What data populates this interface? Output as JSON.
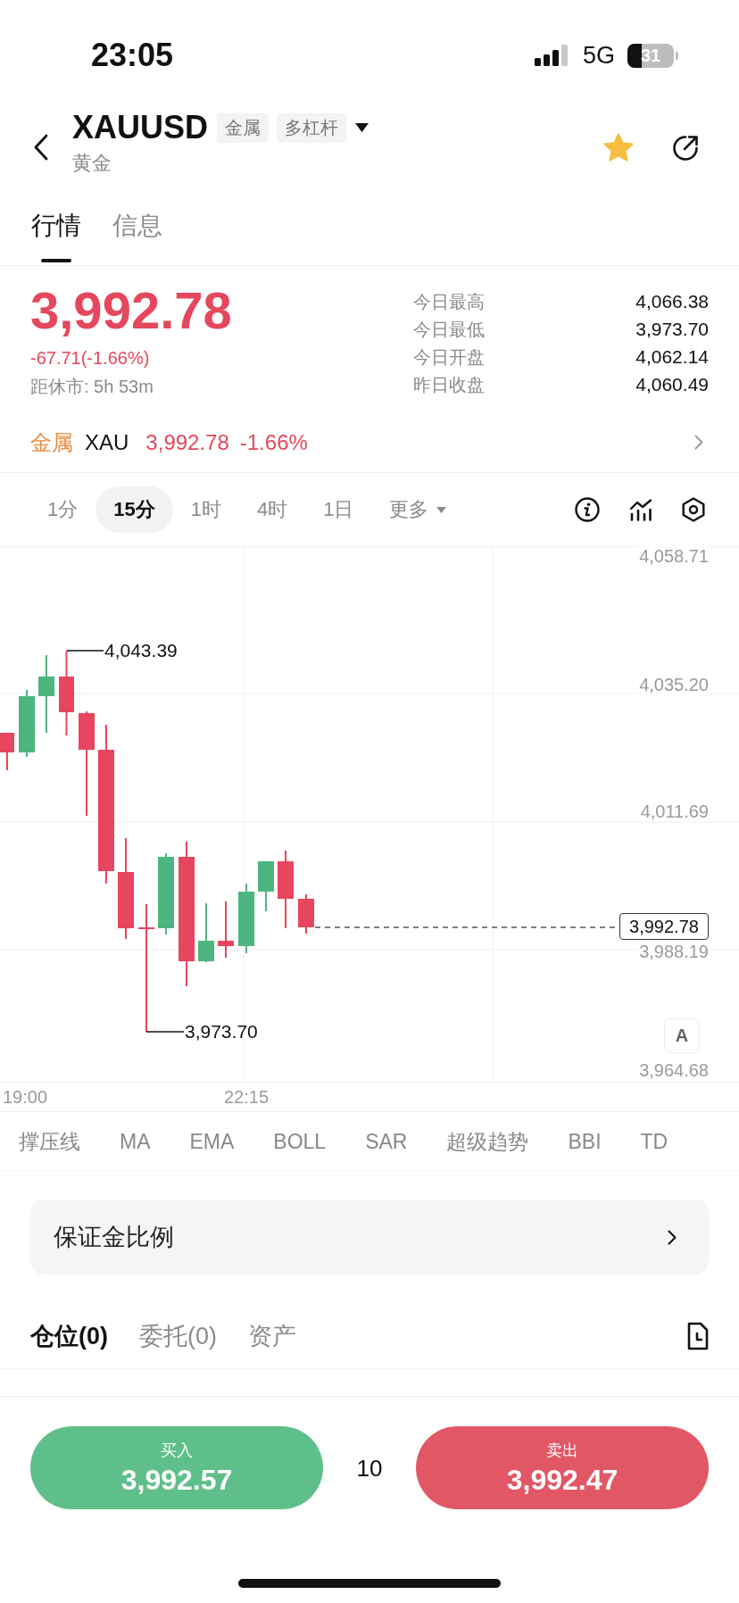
{
  "status_bar": {
    "time": "23:05",
    "network": "5G",
    "battery": "31"
  },
  "header": {
    "symbol": "XAUUSD",
    "tags": [
      "金属",
      "多杠杆"
    ],
    "subtitle": "黄金",
    "favorite": true
  },
  "tabs": [
    {
      "label": "行情",
      "selected": true
    },
    {
      "label": "信息",
      "selected": false
    }
  ],
  "quote": {
    "price": "3,992.78",
    "change": "-67.71(-1.66%)",
    "close_countdown": "距休市: 5h 53m",
    "stats": [
      {
        "label": "今日最高",
        "value": "4,066.38"
      },
      {
        "label": "今日最低",
        "value": "3,973.70"
      },
      {
        "label": "今日开盘",
        "value": "4,062.14"
      },
      {
        "label": "昨日收盘",
        "value": "4,060.49"
      }
    ]
  },
  "index_row": {
    "category": "金属",
    "symbol": "XAU",
    "price": "3,992.78",
    "change": "-1.66%"
  },
  "timeframes": [
    {
      "label": "1分",
      "selected": false,
      "kind": "interval"
    },
    {
      "label": "15分",
      "selected": true,
      "kind": "interval"
    },
    {
      "label": "1时",
      "selected": false,
      "kind": "interval"
    },
    {
      "label": "4时",
      "selected": false,
      "kind": "interval"
    },
    {
      "label": "1日",
      "selected": false,
      "kind": "interval"
    },
    {
      "label": "更多",
      "selected": false,
      "kind": "dropdown"
    }
  ],
  "chart": {
    "y_labels": [
      "4,058.71",
      "4,035.20",
      "4,011.69",
      "3,988.19",
      "3,964.68"
    ],
    "x_labels": [
      "19:00",
      "22:15"
    ],
    "high_label": "4,043.39",
    "low_label": "3,973.70",
    "last_price": "3,992.78",
    "scale_button": "A"
  },
  "indicators": [
    "撑压线",
    "MA",
    "EMA",
    "BOLL",
    "SAR",
    "超级趋势",
    "BBI",
    "TD"
  ],
  "margin_link": {
    "label": "保证金比例"
  },
  "position_tabs": [
    {
      "label": "仓位(0)",
      "selected": true
    },
    {
      "label": "委托(0)",
      "selected": false
    },
    {
      "label": "资产",
      "selected": false
    }
  ],
  "trade_bar": {
    "buy": {
      "label": "买入",
      "price": "3,992.57"
    },
    "quantity": "10",
    "sell": {
      "label": "卖出",
      "price": "3,992.47"
    }
  }
}
